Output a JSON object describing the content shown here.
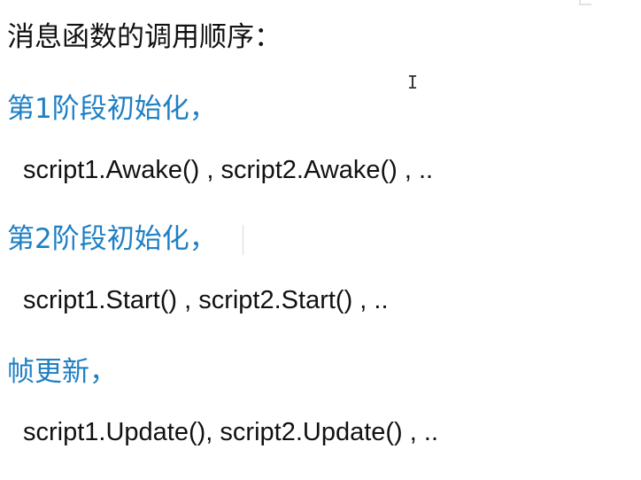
{
  "document": {
    "title": "消息函数的调用顺序：",
    "sections": [
      {
        "heading": "第1阶段初始化，",
        "code": "script1.Awake() , script2.Awake() , .."
      },
      {
        "heading": "第2阶段初始化，",
        "code": "script1.Start() , script2.Start() , .."
      },
      {
        "heading": "帧更新，",
        "code": "script1.Update(), script2.Update() , .."
      }
    ]
  },
  "cursor": {
    "icon": "text-cursor-icon",
    "glyph": "I"
  },
  "colors": {
    "heading": "#1e7fc4",
    "text": "#111111",
    "background": "#ffffff"
  }
}
